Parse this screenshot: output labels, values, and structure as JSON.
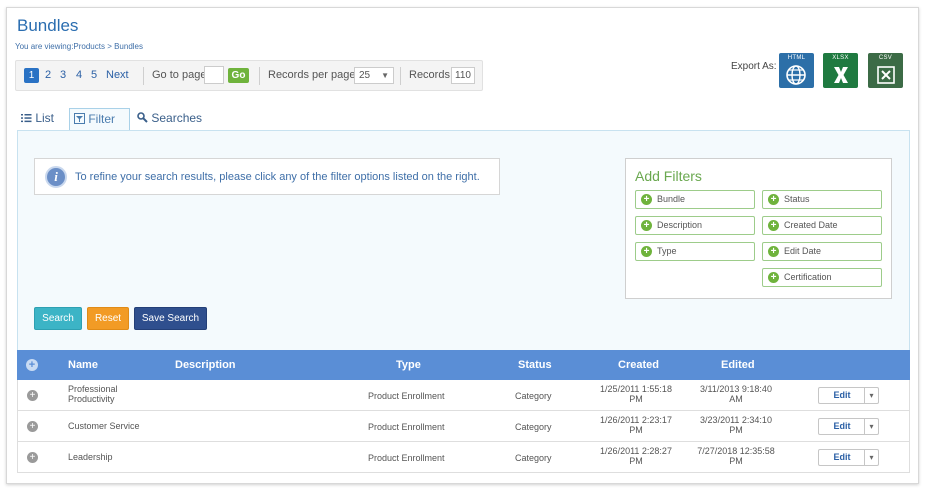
{
  "header": {
    "title": "Bundles",
    "breadcrumb": "You are viewing:Products > Bundles"
  },
  "pager": {
    "pages": [
      "1",
      "2",
      "3",
      "4",
      "5"
    ],
    "next": "Next",
    "goto_label": "Go to page:",
    "go": "Go",
    "rpp_label": "Records per page:",
    "rpp_value": "25",
    "records_label": "Records:",
    "records_value": "110"
  },
  "export": {
    "label": "Export As:",
    "html": "HTML",
    "xlsx": "XLSX",
    "csv": "CSV"
  },
  "tabs": {
    "list": "List",
    "filter": "Filter",
    "searches": "Searches"
  },
  "info_text": "To refine your search results, please click any of the filter options listed on the right.",
  "add_filters": {
    "title": "Add Filters",
    "left": [
      "Bundle",
      "Description",
      "Type"
    ],
    "right": [
      "Status",
      "Created Date",
      "Edit Date",
      "Certification"
    ]
  },
  "actions": {
    "search": "Search",
    "reset": "Reset",
    "save": "Save Search"
  },
  "table": {
    "headers": {
      "name": "Name",
      "description": "Description",
      "type": "Type",
      "status": "Status",
      "created": "Created",
      "edited": "Edited"
    },
    "edit_label": "Edit",
    "rows": [
      {
        "name": "Professional Productivity",
        "type": "Product Enrollment",
        "status": "Category",
        "created": "1/25/2011 1:55:18 PM",
        "edited": "3/11/2013 9:18:40 AM"
      },
      {
        "name": "Customer Service",
        "type": "Product Enrollment",
        "status": "Category",
        "created": "1/26/2011 2:23:17 PM",
        "edited": "3/23/2011 2:34:10 PM"
      },
      {
        "name": "Leadership",
        "type": "Product Enrollment",
        "status": "Category",
        "created": "1/26/2011 2:28:27 PM",
        "edited": "7/27/2018 12:35:58 PM"
      }
    ]
  }
}
